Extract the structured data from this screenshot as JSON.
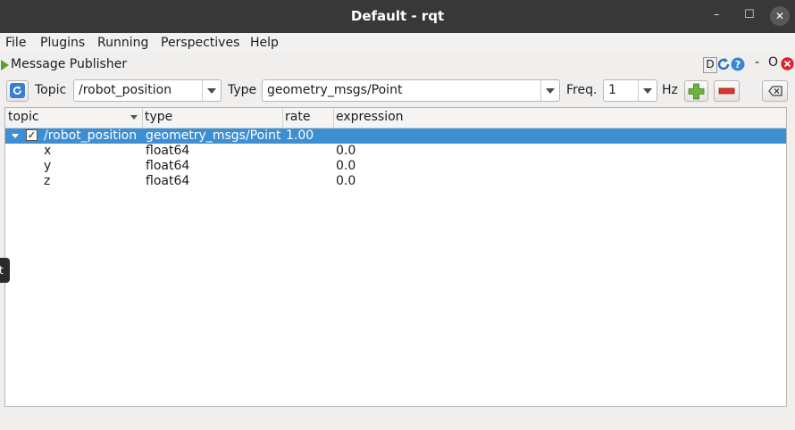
{
  "window": {
    "title": "Default - rqt",
    "minimize": "–",
    "maximize": "☐",
    "close": "✕"
  },
  "menu": {
    "file": "File",
    "plugins": "Plugins",
    "running": "Running",
    "perspectives": "Perspectives",
    "help": "Help"
  },
  "plugin": {
    "title": "Message Publisher",
    "d_label": "D",
    "dash": "-",
    "o_label": "O"
  },
  "toolbar": {
    "topic_label": "Topic",
    "topic_value": "/robot_position",
    "type_label": "Type",
    "type_value": "geometry_msgs/Point",
    "freq_label": "Freq.",
    "freq_value": "1",
    "hz_label": "Hz"
  },
  "tree": {
    "columns": [
      "topic",
      "type",
      "rate",
      "expression"
    ],
    "rows": [
      {
        "topic": "/robot_position",
        "type": "geometry_msgs/Point",
        "rate": "1.00",
        "expression": "",
        "checked": true
      },
      {
        "topic": "x",
        "type": "float64",
        "rate": "",
        "expression": "0.0"
      },
      {
        "topic": "y",
        "type": "float64",
        "rate": "",
        "expression": "0.0"
      },
      {
        "topic": "z",
        "type": "float64",
        "rate": "",
        "expression": "0.0"
      }
    ]
  },
  "side_tab": "t",
  "colors": {
    "titlebar": "#383838",
    "selection": "#3d8fd1",
    "add_green": "#6cb33e",
    "remove_red": "#d9372c"
  }
}
